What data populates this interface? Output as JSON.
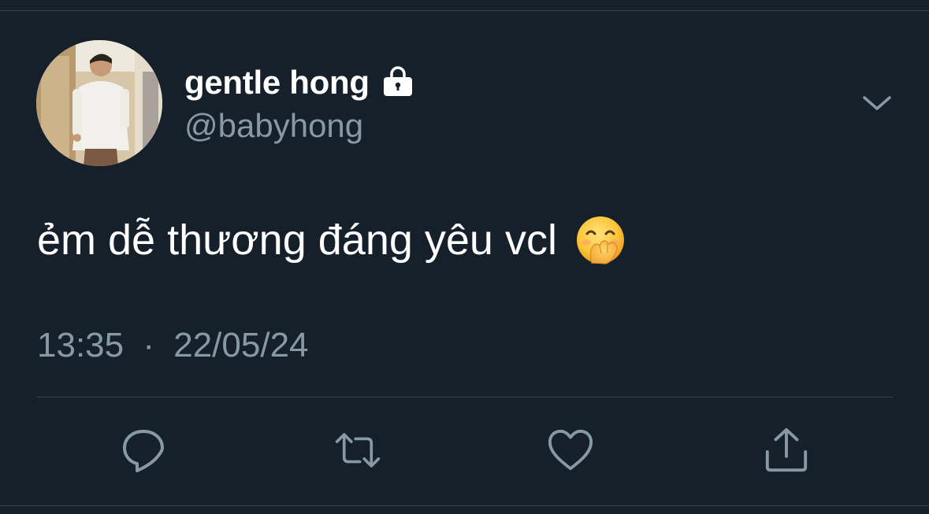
{
  "tweet": {
    "display_name": "gentle hong",
    "handle": "@babyhong",
    "text": "ẻm dễ thương đáng yêu vcl",
    "time": "13:35",
    "separator": "·",
    "date": "22/05/24"
  },
  "icons": {
    "lock": "lock-icon",
    "caret": "chevron-down-icon",
    "emoji": "face-with-hand-over-mouth-emoji",
    "reply": "reply-icon",
    "retweet": "retweet-icon",
    "like": "heart-icon",
    "share": "share-icon"
  },
  "colors": {
    "background": "#15202b",
    "primary_text": "#ffffff",
    "secondary_text": "#8899a6",
    "divider": "#38444d"
  }
}
